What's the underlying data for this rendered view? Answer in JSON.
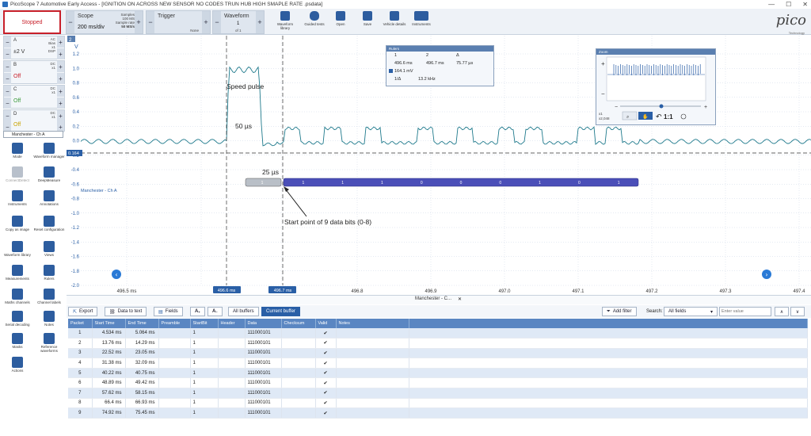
{
  "window": {
    "title": "PicoScope 7 Automotive Early Access - [IGNITION ON ACROSS NEW SENSOR NO CODES TRUN HUB HIGH SMAPLE RATE .psdata]"
  },
  "toolbar": {
    "stopped": "Stopped",
    "scope_label": "Scope",
    "timebase": "200 ms/div",
    "samples_label": "Samples",
    "samples_value": "100 MS",
    "sample_rate_label": "Sample rate",
    "sample_rate_value": "50 MS/s",
    "trigger_label": "Trigger",
    "trigger_mode": "None",
    "waveform_label": "Waveform",
    "waveform_index": "1",
    "waveform_total": "of 1",
    "buttons": [
      "Waveform library",
      "Guided tests",
      "Open",
      "Save",
      "Vehicle details",
      "Instruments"
    ],
    "brand": "pico",
    "brand_sub": "Technology"
  },
  "channels": [
    {
      "name": "A",
      "coupling": "AC",
      "extra1": "Bias",
      "extra2": "x1",
      "extra3": "DSP",
      "range": "±2 V",
      "color": "#2a5fa6"
    },
    {
      "name": "B",
      "coupling": "DC",
      "extra1": "x1",
      "range": "Off",
      "color": "#c8202a"
    },
    {
      "name": "C",
      "coupling": "DC",
      "extra1": "x1",
      "range": "Off",
      "color": "#3a9a3a"
    },
    {
      "name": "D",
      "coupling": "DC",
      "extra1": "x1",
      "range": "Off",
      "color": "#c9a400"
    }
  ],
  "decoder_select": "Manchester - Ch A",
  "tools": [
    "Mode",
    "Waveform manager",
    "ConnectDetect",
    "DeepMeasure",
    "Instruments",
    "Annotations",
    "Copy as image",
    "Reset configuration",
    "Waveform library",
    "Views",
    "Measurements",
    "Rulers",
    "Maths channels",
    "Channel labels",
    "Serial decoding",
    "Notes",
    "Masks",
    "Reference waveforms",
    "Actions"
  ],
  "scope": {
    "y_unit": "V",
    "y_ticks": [
      "1.2",
      "1.0",
      "0.8",
      "0.6",
      "0.4",
      "0.2",
      "0.0",
      "-0.2",
      "-0.4",
      "-0.6",
      "-0.8",
      "-1.0",
      "-1.2",
      "-1.4",
      "-1.6",
      "-1.8",
      "-2.0"
    ],
    "x_ticks": [
      "496.5 ms",
      "496.8",
      "496.9",
      "497.0",
      "497.1",
      "497.2",
      "497.3",
      "497.4"
    ],
    "ruler1_label": "496.6 ms",
    "ruler2_label": "496.7 ms",
    "h_ruler_label": "0.164",
    "annotation_speed": "Speed pulse",
    "annotation_50": "50 µs",
    "annotation_25": "25 µs",
    "annotation_start": "Start point of 9 data bits (0-8)",
    "decoder_label": "Manchester - Ch A",
    "decoder_header_value": "1",
    "decoder_bits": [
      "1",
      "1",
      "1",
      "0",
      "0",
      "0",
      "1",
      "0",
      "1"
    ],
    "zoom_label": "2"
  },
  "rulers_window": {
    "title": "Rulers",
    "col1": "1",
    "col2": "2",
    "col3": "Δ",
    "t1": "496.6 ms",
    "t2": "496.7 ms",
    "dt": "75.77 µs",
    "v1": "164.1 mV",
    "inv_label": "1/Δ",
    "freq": "13.2 kHz"
  },
  "zoom_window": {
    "title": "Zoom",
    "ratio": "1:1",
    "x_label": "x1",
    "y_label": "x2,048"
  },
  "tab_label": "Manchester - C...",
  "decoder_toolbar": {
    "export": "Export",
    "data_to_text": "Data to text",
    "fields": "Fields",
    "all_buffers": "All buffers",
    "current_buffer": "Current buffer",
    "add_filter": "Add filter",
    "search_label": "Search:",
    "search_scope": "All fields",
    "search_placeholder": "Enter value"
  },
  "table": {
    "headers": [
      "Packet",
      "Start Time",
      "End Time",
      "Preamble",
      "StartBit",
      "Header",
      "Data",
      "Checksum",
      "Valid",
      "Notes"
    ],
    "rows": [
      [
        "1",
        "4.534 ms",
        "5.064 ms",
        "",
        "1",
        "",
        "111000101",
        "",
        "✔",
        ""
      ],
      [
        "2",
        "13.76 ms",
        "14.29 ms",
        "",
        "1",
        "",
        "111000101",
        "",
        "✔",
        ""
      ],
      [
        "3",
        "22.52 ms",
        "23.05 ms",
        "",
        "1",
        "",
        "111000101",
        "",
        "✔",
        ""
      ],
      [
        "4",
        "31.38 ms",
        "32.09 ms",
        "",
        "1",
        "",
        "111000101",
        "",
        "✔",
        ""
      ],
      [
        "5",
        "40.22 ms",
        "40.75 ms",
        "",
        "1",
        "",
        "111000101",
        "",
        "✔",
        ""
      ],
      [
        "6",
        "48.89 ms",
        "49.42 ms",
        "",
        "1",
        "",
        "111000101",
        "",
        "✔",
        ""
      ],
      [
        "7",
        "57.62 ms",
        "58.15 ms",
        "",
        "1",
        "",
        "111000101",
        "",
        "✔",
        ""
      ],
      [
        "8",
        "66.4 ms",
        "66.93 ms",
        "",
        "1",
        "",
        "111000101",
        "",
        "✔",
        ""
      ],
      [
        "9",
        "74.92 ms",
        "75.45 ms",
        "",
        "1",
        "",
        "111000101",
        "",
        "✔",
        ""
      ]
    ]
  }
}
